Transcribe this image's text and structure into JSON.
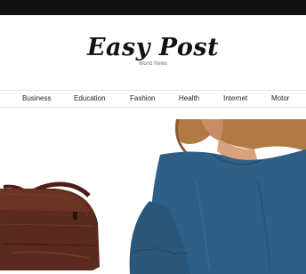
{
  "site": {
    "title": "Easy Post",
    "tagline": "World News"
  },
  "nav": {
    "items": [
      {
        "label": "Business"
      },
      {
        "label": "Education"
      },
      {
        "label": "Fashion"
      },
      {
        "label": "Health"
      },
      {
        "label": "Internet"
      },
      {
        "label": "Motor"
      }
    ]
  },
  "colors": {
    "topbar": "#111111",
    "background": "#ffffff",
    "nav_border": "#e3e3e3",
    "text": "#222222",
    "bag_leather": "#5a2a1e",
    "shirt_blue": "#2e5f86"
  },
  "hero": {
    "image_subjects": [
      "brown-leather-handbag",
      "woman-in-blue-blouse"
    ]
  }
}
